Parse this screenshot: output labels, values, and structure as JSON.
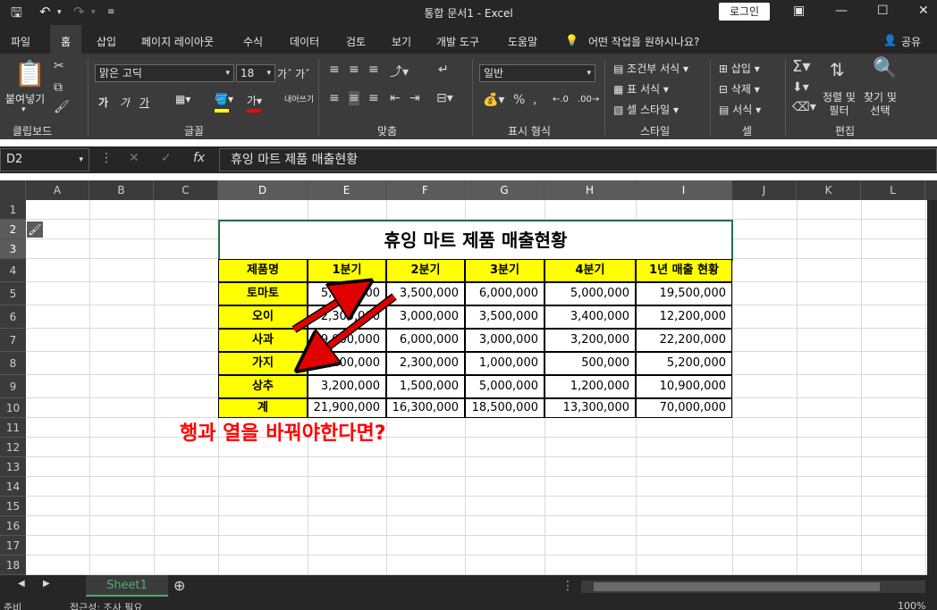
{
  "titlebar": {
    "title": "통합 문서1  -  Excel",
    "login_label": "로그인",
    "save_icon": "save-icon",
    "undo_icon": "undo-icon",
    "redo_icon": "redo-icon"
  },
  "tabs": [
    "파일",
    "홈",
    "삽입",
    "페이지 레이아웃",
    "수식",
    "데이터",
    "검토",
    "보기",
    "개발 도구",
    "도움말"
  ],
  "active_tab": "홈",
  "tellme": "어떤 작업을 원하시나요?",
  "share": "공유",
  "ribbon": {
    "paste": "붙여넣기",
    "font_name": "맑은 고딕",
    "font_size": "18",
    "wrap": "내어쓰기",
    "number_format": "일반",
    "cond_format": "조건부 서식",
    "table_format": "표 서식",
    "cell_style": "셀 스타일",
    "insert": "삽입",
    "delete": "삭제",
    "format": "서식",
    "sort_filter": "정렬 및\n필터",
    "find_select": "찾기 및\n선택",
    "groups": [
      "클립보드",
      "글꼴",
      "맞춤",
      "표시 형식",
      "스타일",
      "셀",
      "편집"
    ],
    "wrap_label": "내어쓰기"
  },
  "formula_bar": {
    "name_box": "D2",
    "content": "휴잉 마트 제품 매출현황"
  },
  "columns": [
    "A",
    "B",
    "C",
    "D",
    "E",
    "F",
    "G",
    "H",
    "I",
    "J",
    "K",
    "L"
  ],
  "rows": [
    "1",
    "2",
    "3",
    "4",
    "5",
    "6",
    "7",
    "8",
    "9",
    "10",
    "11",
    "12",
    "13",
    "14",
    "15",
    "16",
    "17",
    "18"
  ],
  "table": {
    "title": "휴잉 마트 제품 매출현황",
    "headers": [
      "제품명",
      "1분기",
      "2분기",
      "3분기",
      "4분기",
      "1년 매출 현황"
    ],
    "rows": [
      [
        "토마토",
        "5,000,000",
        "3,500,000",
        "6,000,000",
        "5,000,000",
        "19,500,000"
      ],
      [
        "오이",
        "2,300,000",
        "3,000,000",
        "3,500,000",
        "3,400,000",
        "12,200,000"
      ],
      [
        "사과",
        "9,000,000",
        "6,000,000",
        "3,000,000",
        "3,200,000",
        "22,200,000"
      ],
      [
        "가지",
        "1,400,000",
        "2,300,000",
        "1,000,000",
        "500,000",
        "5,200,000"
      ],
      [
        "상추",
        "3,200,000",
        "1,500,000",
        "5,000,000",
        "1,200,000",
        "10,900,000"
      ],
      [
        "계",
        "21,900,000",
        "16,300,000",
        "18,500,000",
        "13,300,000",
        "70,000,000"
      ]
    ]
  },
  "annotation": "행과 열을 바꿔야한다면?",
  "sheet_tab": "Sheet1",
  "status": {
    "ready": "준비",
    "accessibility": "접근성: 조사 필요",
    "zoom": "100%"
  },
  "colors": {
    "highlight": "#ffff00",
    "annotation": "#ff0000",
    "arrow": "#e00000"
  }
}
